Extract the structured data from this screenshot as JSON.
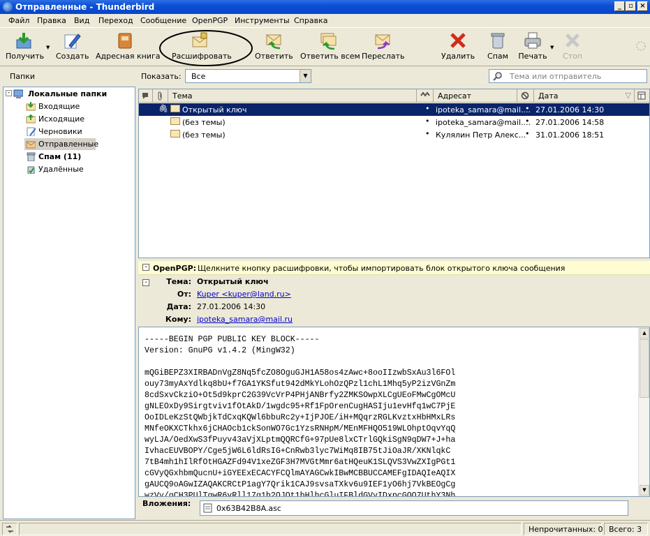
{
  "window": {
    "title": "Отправленные - Thunderbird"
  },
  "menu": [
    "Файл",
    "Правка",
    "Вид",
    "Переход",
    "Сообщение",
    "OpenPGP",
    "Инструменты",
    "Справка"
  ],
  "toolbar": {
    "get": "Получить",
    "create": "Создать",
    "addressbook": "Адресная книга",
    "decrypt": "Расшифровать",
    "reply": "Ответить",
    "replyall": "Ответить всем",
    "forward": "Переслать",
    "delete": "Удалить",
    "spam": "Спам",
    "print": "Печать",
    "stop": "Стоп"
  },
  "filterbar": {
    "folders_label": "Папки",
    "show_label": "Показать:",
    "show_value": "Все",
    "search_placeholder": "Тема или отправитель"
  },
  "folders": {
    "root": "Локальные папки",
    "items": [
      "Входящие",
      "Исходящие",
      "Черновики",
      "Отправленные",
      "Спам (11)",
      "Удалённые"
    ]
  },
  "thread": {
    "headers": {
      "subject": "Тема",
      "recipient": "Адресат",
      "date": "Дата"
    },
    "rows": [
      {
        "subject": "Открытый ключ",
        "recipient": "ipoteka_samara@mail....",
        "date": "27.01.2006 14:30"
      },
      {
        "subject": "(без темы)",
        "recipient": "ipoteka_samara@mail....",
        "date": "27.01.2006 14:58"
      },
      {
        "subject": "(без темы)",
        "recipient": "Кулялин Петр Алекс...",
        "date": "31.01.2006 18:51"
      }
    ]
  },
  "message": {
    "pgp_label": "OpenPGP:",
    "pgp_text": "Щелкните кнопку расшифровки, чтобы импортировать блок открытого ключа сообщения",
    "subject_label": "Тема:",
    "subject": "Открытый ключ",
    "from_label": "От:",
    "from": "Kuper <kuper@land.ru>",
    "date_label": "Дата:",
    "date": "27.01.2006 14:30",
    "to_label": "Кому:",
    "to": "ipoteka_samara@mail.ru",
    "body": "-----BEGIN PGP PUBLIC KEY BLOCK-----\nVersion: GnuPG v1.4.2 (MingW32)\n\nmQGiBEPZ3XIRBADnVgZ8Nq5fcZO8OguGJH1A58os4zAwc+8ooIIzwbSxAu3l6FOl\nouy73myAxYdlkq8bU+f7GA1YKSfut942dMkYLohOzQPzl1chL1Mhq5yP2izVGnZm\n8cdSxvCkziO+Ot5d9kprC2G39VcVrP4PHjANBrfy2ZMKSOwpXLCgUEoFMwCgOMcU\ngNLEOxDy9Sirgtviv1fOtAkD/1wgdc95+Rf1FpOrenCugHASIju1evHfq1wC7PjE\nOoIDLeKzStQWbjkTdCxqKQWl6bbuRc2y+IjPJOE/iH+MQqrzRGLKvztxHbHMxLRs\nMNfeOKXCTkhx6jCHAOcb1ckSonWO7Gc1YzsRNHpM/MEnMFHQO519WLOhptOqvYqQ\nwyLJA/OedXwS3fPuyv43aVjXLptmQQRCfG+97pUe8lxCTrlGQkiSgN9qDW7+J+ha\nIvhacEUVBOPY/Cge5jW6L6ldRsIG+CnRwb3lyc7WiMq8IB75tJiOaJR/XKNlqkC\n7tB4mh1hIlRfOtHGAZFd94V1xeZGF3H7MVGtMmr6atHQeuK1SLQVS3VwZXIgPGt1\ncGVyQGxhbmQucnU+iGYEExECACYFCQlmAYAGCwkIBwMCBBUCCAMEFgIDAQIeAQIX\ngAUCQ9oAGwIZAQAKCRCtP1agY7Qrik1CAJ9svsaTXkv6u9IEF1yO6hj7VkBEOgCg\nwzVy/gCH3PUlTqwR6vRll17g1b2OJQt1bHlhcGluIFBldGVyIDxpcGOO7UthY3Nh"
  },
  "attachments": {
    "label": "Вложения:",
    "file": "0x63B42B8A.asc"
  },
  "status": {
    "unread": "Непрочитанных: 0",
    "total": "Всего: 3"
  }
}
